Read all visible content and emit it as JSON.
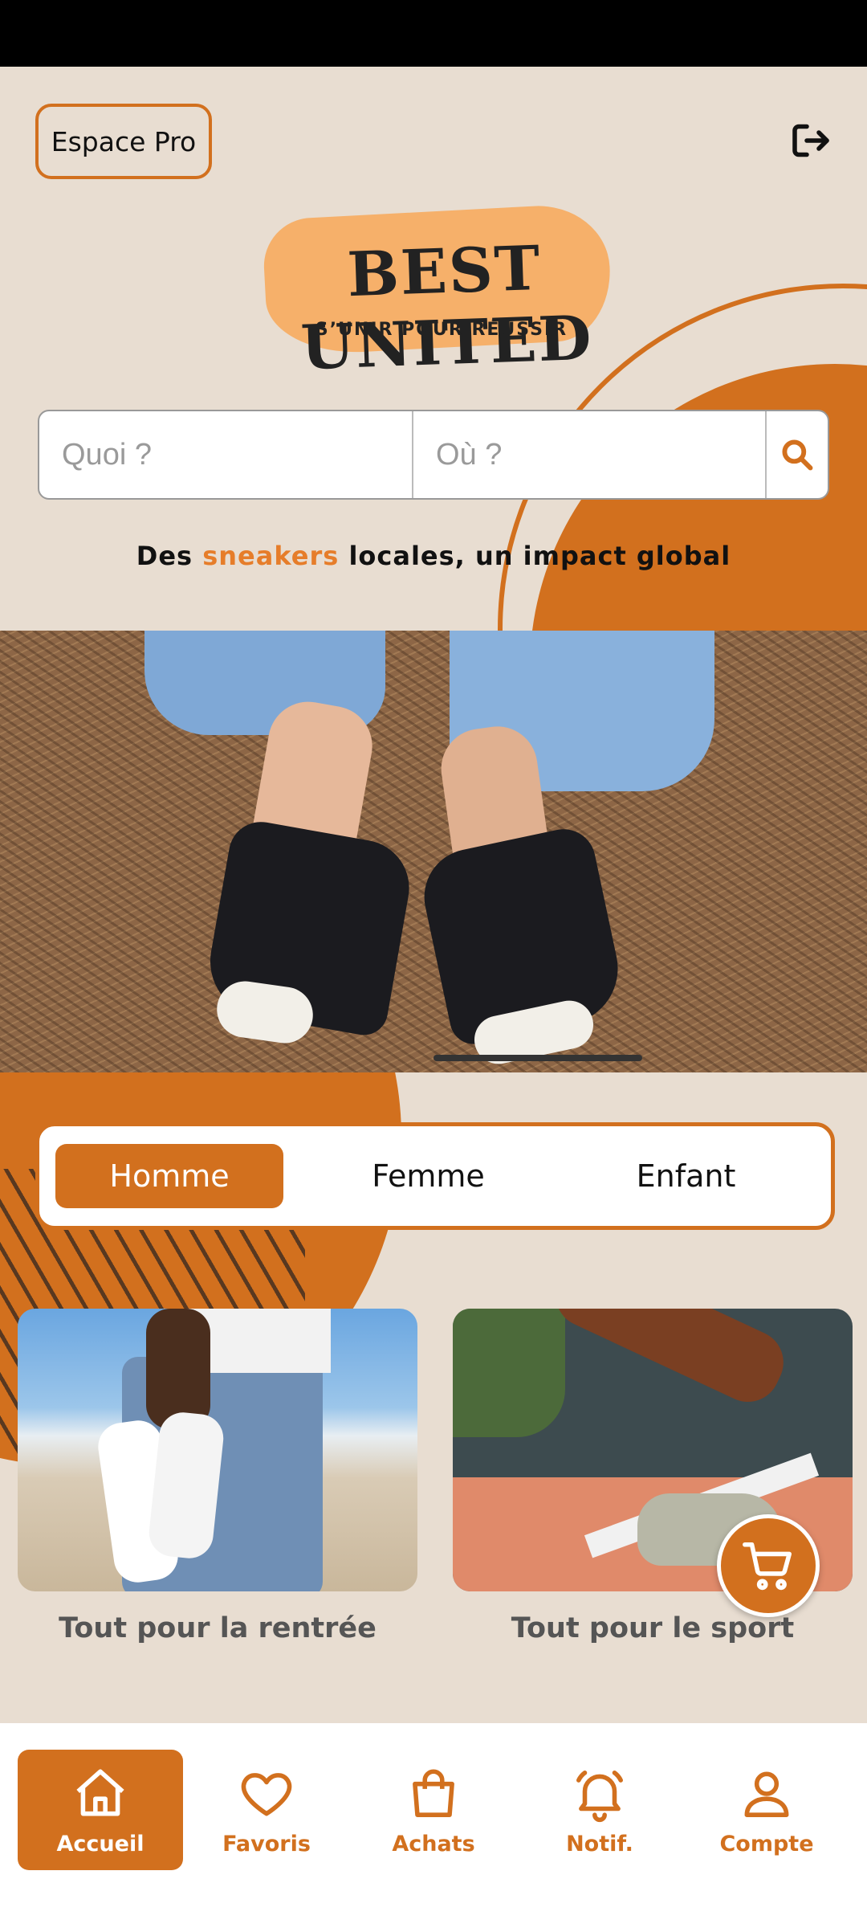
{
  "header": {
    "espace_pro_label": "Espace Pro",
    "logout_icon": "logout-icon"
  },
  "logo": {
    "title": "BEST UNITED",
    "subtitle": "S’UNIR POUR RÉUSSIR"
  },
  "search": {
    "what_placeholder": "Quoi ?",
    "where_placeholder": "Où ?",
    "button_icon": "search-icon"
  },
  "tagline": {
    "part1": "Des ",
    "highlight": "sneakers",
    "part2": " locales, un impact global"
  },
  "segments": {
    "items": [
      "Homme",
      "Femme",
      "Enfant"
    ],
    "selected": "Homme"
  },
  "cards": [
    {
      "label": "Tout pour la rentrée"
    },
    {
      "label": "Tout pour le sport"
    }
  ],
  "cart_fab_icon": "cart-icon",
  "bottom_nav": {
    "items": [
      {
        "label": "Accueil",
        "icon": "home-icon",
        "active": true
      },
      {
        "label": "Favoris",
        "icon": "heart-icon",
        "active": false
      },
      {
        "label": "Achats",
        "icon": "shopping-bag-icon",
        "active": false
      },
      {
        "label": "Notif.",
        "icon": "bell-icon",
        "active": false
      },
      {
        "label": "Compte",
        "icon": "user-icon",
        "active": false
      }
    ]
  },
  "colors": {
    "accent": "#d2701e",
    "background": "#e8ddd1",
    "tagline_highlight": "#e67d2a"
  }
}
